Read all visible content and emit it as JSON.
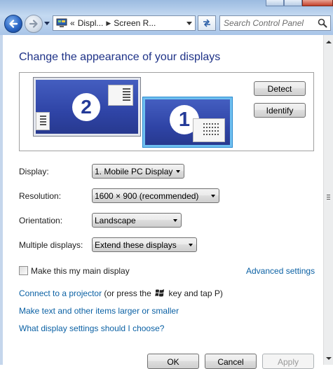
{
  "address_bar": {
    "prefix": "«",
    "segments": [
      "Displ...",
      "Screen R..."
    ]
  },
  "search": {
    "placeholder": "Search Control Panel"
  },
  "heading": "Change the appearance of your displays",
  "monitors": [
    {
      "number": "2",
      "active": false
    },
    {
      "number": "1",
      "active": true
    }
  ],
  "buttons": {
    "detect": "Detect",
    "identify": "Identify"
  },
  "settings": {
    "display": {
      "label": "Display:",
      "value": "1. Mobile PC Display"
    },
    "resolution": {
      "label": "Resolution:",
      "value": "1600 × 900 (recommended)"
    },
    "orientation": {
      "label": "Orientation:",
      "value": "Landscape"
    },
    "multiple": {
      "label": "Multiple displays:",
      "value": "Extend these displays"
    }
  },
  "main_display": {
    "label": "Make this my main display",
    "checked": false
  },
  "advanced_link": "Advanced settings",
  "projector": {
    "link": "Connect to a projector",
    "text_before": " (or press the ",
    "text_after": " key and tap P)"
  },
  "larger_text_link": "Make text and other items larger or smaller",
  "help_link": "What display settings should I choose?",
  "footer": {
    "ok": "OK",
    "cancel": "Cancel",
    "apply": "Apply"
  }
}
